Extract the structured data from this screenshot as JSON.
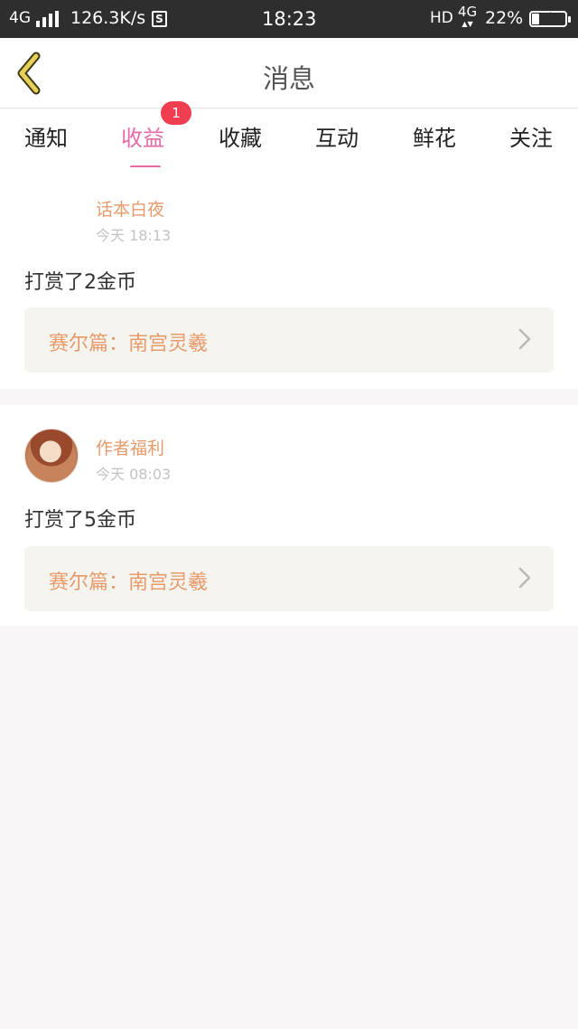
{
  "status_bar": {
    "network": "4G",
    "speed": "126.3K/s",
    "s_icon": "S",
    "time": "18:23",
    "hd": "HD",
    "network2": "4G",
    "battery_pct": "22%",
    "battery_level": 0.22
  },
  "header": {
    "title": "消息",
    "back_icon": "chevron-left-icon"
  },
  "tabs": [
    {
      "label": "通知"
    },
    {
      "label": "收益",
      "badge": "1"
    },
    {
      "label": "收藏"
    },
    {
      "label": "互动"
    },
    {
      "label": "鲜花"
    },
    {
      "label": "关注"
    }
  ],
  "active_tab": 1,
  "messages": [
    {
      "sender": "话本白夜",
      "time": "今天 18:13",
      "text": "打赏了2金币",
      "link": "赛尔篇：南宫灵羲"
    },
    {
      "sender": "作者福利",
      "time": "今天 08:03",
      "text": "打赏了5金币",
      "link": "赛尔篇：南宫灵羲"
    }
  ],
  "colors": {
    "accent": "#e76aa8",
    "badge": "#ee3e4f",
    "sender": "#e79a6b",
    "back_icon": "#e8cf55"
  }
}
